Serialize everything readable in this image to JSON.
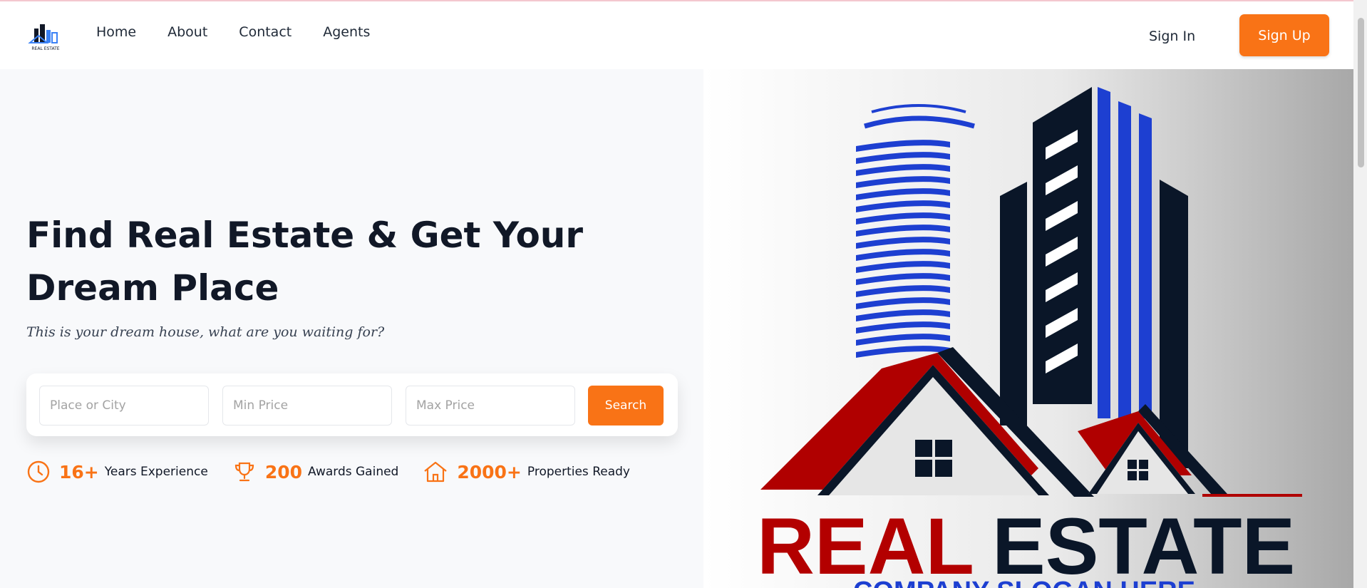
{
  "nav": {
    "brand_text": "REAL ESTATE",
    "links": [
      "Home",
      "About",
      "Contact",
      "Agents"
    ],
    "signin_label": "Sign In",
    "signup_label": "Sign Up"
  },
  "hero": {
    "title": "Find Real Estate & Get Your Dream Place",
    "subtitle": "This is your dream house, what are you waiting for?",
    "search": {
      "place_placeholder": "Place or City",
      "min_placeholder": "Min Price",
      "max_placeholder": "Max Price",
      "button_label": "Search"
    },
    "stats": [
      {
        "icon": "clock-icon",
        "value": "16+",
        "label": "Years Experience"
      },
      {
        "icon": "trophy-icon",
        "value": "200",
        "label": "Awards Gained"
      },
      {
        "icon": "home-icon",
        "value": "2000+",
        "label": "Properties Ready"
      }
    ]
  },
  "hero_image": {
    "word1": "REAL",
    "word2": "ESTATE",
    "slogan": "COMPANY SLOGAN HERE"
  },
  "colors": {
    "accent": "#f97316",
    "dark": "#111827",
    "logo_red": "#b30000",
    "logo_blue": "#1d3fd1",
    "logo_navy": "#0a1628"
  }
}
